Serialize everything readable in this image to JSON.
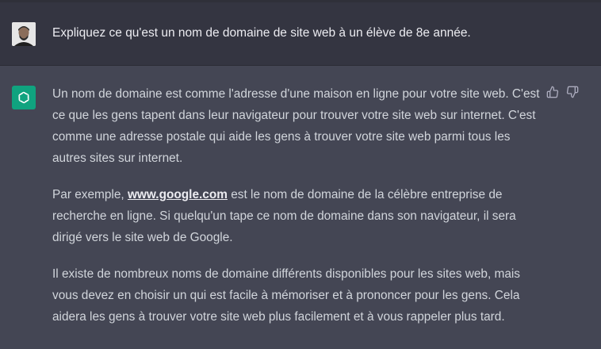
{
  "user_message": {
    "avatar": "user-avatar-photo",
    "text": "Expliquez ce qu'est un nom de domaine de site web à un élève de 8e année."
  },
  "assistant_message": {
    "icon": "openai-logo-icon",
    "paragraph1": "Un nom de domaine est comme l'adresse d'une maison en ligne pour votre site web. C'est ce que les gens tapent dans leur navigateur pour trouver votre site web sur internet. C'est comme une adresse postale qui aide les gens à trouver votre site web parmi tous les autres sites sur internet.",
    "paragraph2_before": "Par exemple, ",
    "paragraph2_link": "www.google.com",
    "paragraph2_after": " est le nom de domaine de la célèbre entreprise de recherche en ligne. Si quelqu'un tape ce nom de domaine dans son navigateur, il sera dirigé vers le site web de Google.",
    "paragraph3": "Il existe de nombreux noms de domaine différents disponibles pour les sites web, mais vous devez en choisir un qui est facile à mémoriser et à prononcer pour les gens. Cela aidera les gens à trouver votre site web plus facilement et à vous rappeler plus tard."
  },
  "feedback": {
    "like_icon": "thumbs-up-icon",
    "dislike_icon": "thumbs-down-icon"
  },
  "colors": {
    "user_bg": "#343541",
    "assistant_bg": "#444654",
    "accent": "#10a37f",
    "text": "#d1d5db"
  }
}
